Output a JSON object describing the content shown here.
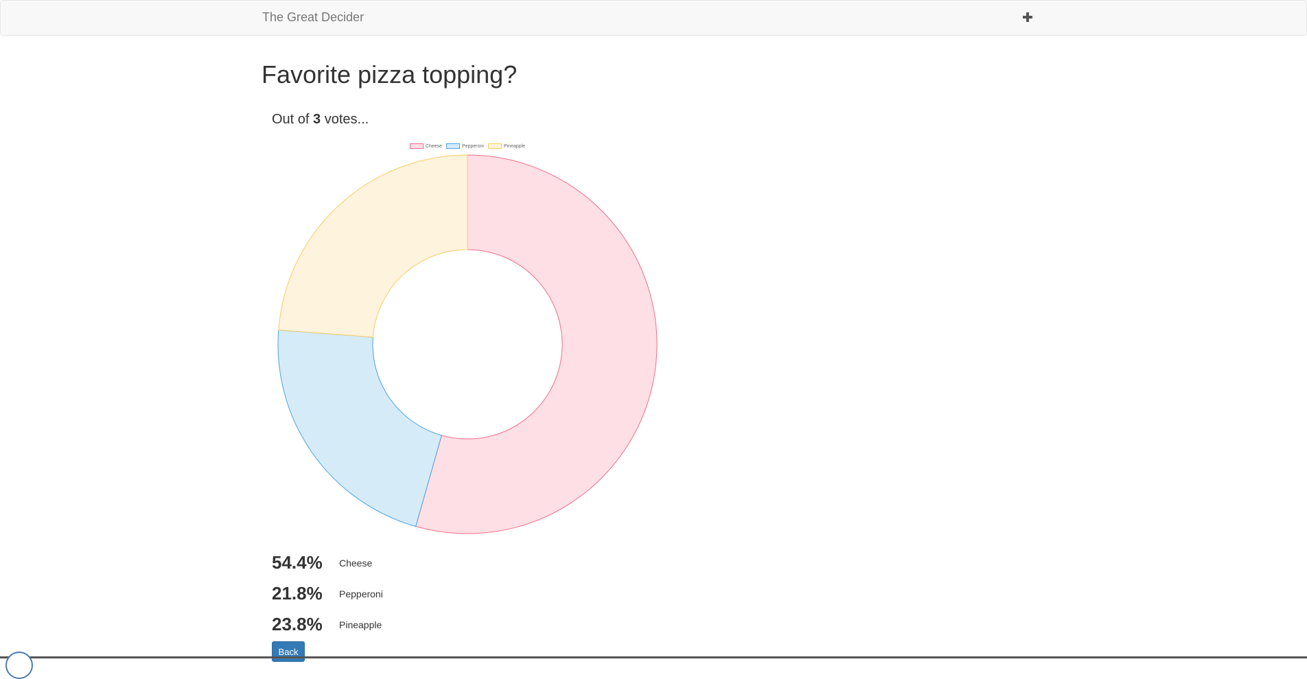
{
  "navbar": {
    "brand": "The Great Decider",
    "add_icon": "plus-icon"
  },
  "poll": {
    "title": "Favorite pizza topping?",
    "votes_prefix": "Out of ",
    "votes_count": "3",
    "votes_suffix": " votes..."
  },
  "chart_data": {
    "type": "pie",
    "variant": "doughnut",
    "categories": [
      "Cheese",
      "Pepperoni",
      "Pineapple"
    ],
    "values": [
      54.4,
      21.8,
      23.8
    ],
    "legend_position": "top",
    "colors": {
      "fill": [
        "#fddfe5",
        "#d6ebf8",
        "#fef3dc"
      ],
      "stroke": [
        "#f06e8a",
        "#4aa3df",
        "#f9cd63"
      ]
    }
  },
  "results": [
    {
      "pct": "54.4%",
      "label": "Cheese"
    },
    {
      "pct": "21.8%",
      "label": "Pepperoni"
    },
    {
      "pct": "23.8%",
      "label": "Pineapple"
    }
  ],
  "actions": {
    "back_label": "Back"
  },
  "colors": {
    "primary": "#337ab7",
    "navbar_bg": "#f8f8f8"
  }
}
